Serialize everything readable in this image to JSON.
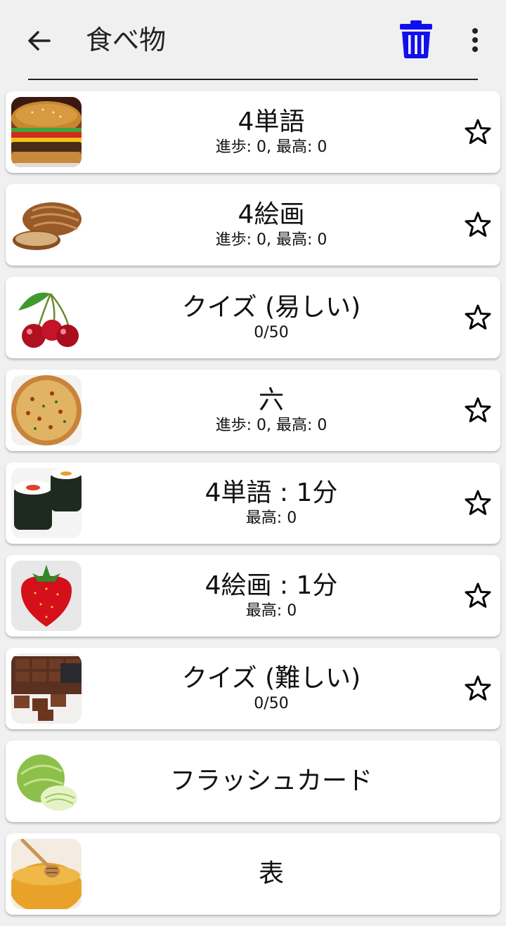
{
  "header": {
    "title": "食べ物",
    "trash_color": "#1010ee"
  },
  "items": [
    {
      "title": "4単語",
      "subtitle": "進歩: 0, 最高: 0",
      "image": "hamburger-image"
    },
    {
      "title": "4絵画",
      "subtitle": "進歩: 0, 最高: 0",
      "image": "bread-image"
    },
    {
      "title": "クイズ (易しい)",
      "subtitle": "0/50",
      "image": "cherries-image"
    },
    {
      "title": "六",
      "subtitle": "進歩: 0, 最高: 0",
      "image": "pizza-image"
    },
    {
      "title": "4単語 : 1分",
      "subtitle": "最高: 0",
      "image": "sushi-image"
    },
    {
      "title": "4絵画 : 1分",
      "subtitle": "最高: 0",
      "image": "strawberry-image"
    },
    {
      "title": "クイズ (難しい)",
      "subtitle": "0/50",
      "image": "chocolate-image"
    },
    {
      "title": "フラッシュカード",
      "subtitle": "",
      "image": "cabbage-image"
    },
    {
      "title": "表",
      "subtitle": "",
      "image": "honey-image"
    }
  ]
}
